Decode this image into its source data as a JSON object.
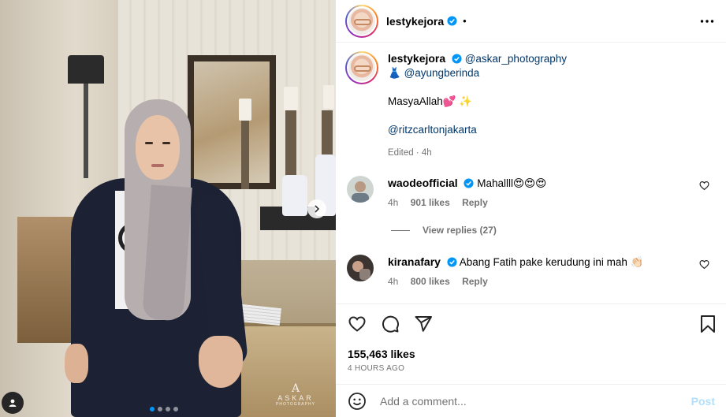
{
  "post": {
    "username": "lestykejora",
    "header_dot": "•",
    "photo_watermark": {
      "mark": "A",
      "title": "ASKAR",
      "subtitle": "PHOTOGRAPHY"
    },
    "carousel": {
      "count": 4,
      "active_index": 0
    }
  },
  "caption": {
    "username": "lestykejora",
    "mention_1": "@askar_photography",
    "dress_emoji": "👗",
    "mention_2": "@ayungberinda",
    "text": "MasyaAllah💕 ✨",
    "mention_3": "@ritzcarltonjakarta",
    "edited": "Edited · 4h"
  },
  "comments": [
    {
      "username": "waodeofficial",
      "text": "Mahallll😍😍😍",
      "time": "4h",
      "likes": "901 likes",
      "reply": "Reply",
      "view_replies": "View replies (27)"
    },
    {
      "username": "kiranafary",
      "text": "Abang Fatih pake kerudung ini mah 👏🏻",
      "time": "4h",
      "likes": "800 likes",
      "reply": "Reply"
    }
  ],
  "actions": {
    "likes": "155,463 likes",
    "time_ago": "4 HOURS AGO"
  },
  "add_comment": {
    "placeholder": "Add a comment...",
    "post_label": "Post"
  },
  "colors": {
    "verified": "#0095f6",
    "link": "#00376b",
    "muted": "#737373",
    "post_disabled": "#b2dffc"
  },
  "icons": {
    "more": "more-horizontal-icon",
    "like": "heart-icon",
    "comment": "comment-bubble-icon",
    "share": "send-icon",
    "save": "bookmark-icon",
    "emoji": "smiley-icon",
    "next": "chevron-right-icon",
    "tags": "user-tag-icon"
  }
}
